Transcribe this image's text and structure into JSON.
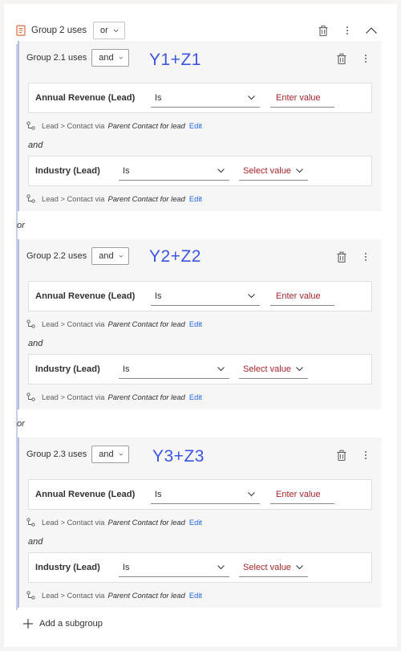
{
  "outer_group": {
    "title": "Group 2 uses",
    "operator": "or"
  },
  "subgroups": [
    {
      "title": "Group 2.1 uses",
      "operator": "and",
      "annotation": "Y1+Z1",
      "conditions": [
        {
          "field": "Annual Revenue (Lead)",
          "operator": "Is",
          "value_placeholder": "Enter value"
        },
        {
          "field": "Industry (Lead)",
          "operator": "Is",
          "value_placeholder": "Select value"
        }
      ]
    },
    {
      "title": "Group 2.2 uses",
      "operator": "and",
      "annotation": "Y2+Z2",
      "conditions": [
        {
          "field": "Annual Revenue (Lead)",
          "operator": "Is",
          "value_placeholder": "Enter value"
        },
        {
          "field": "Industry (Lead)",
          "operator": "Is",
          "value_placeholder": "Select value"
        }
      ]
    },
    {
      "title": "Group 2.3 uses",
      "operator": "and",
      "annotation": "Y3+Z3",
      "conditions": [
        {
          "field": "Annual Revenue (Lead)",
          "operator": "Is",
          "value_placeholder": "Enter value"
        },
        {
          "field": "Industry (Lead)",
          "operator": "Is",
          "value_placeholder": "Select value"
        }
      ]
    }
  ],
  "relationship": {
    "path": "Lead > Contact via",
    "via": "Parent Contact for lead",
    "edit": "Edit"
  },
  "inner_connector": "and",
  "between_connector": "or",
  "add_subgroup_label": "Add a subgroup",
  "colors": {
    "accent_link": "#2266e3",
    "annotation": "#3c55e0",
    "placeholder": "#a4262c",
    "group_icon": "#d86a3c"
  }
}
